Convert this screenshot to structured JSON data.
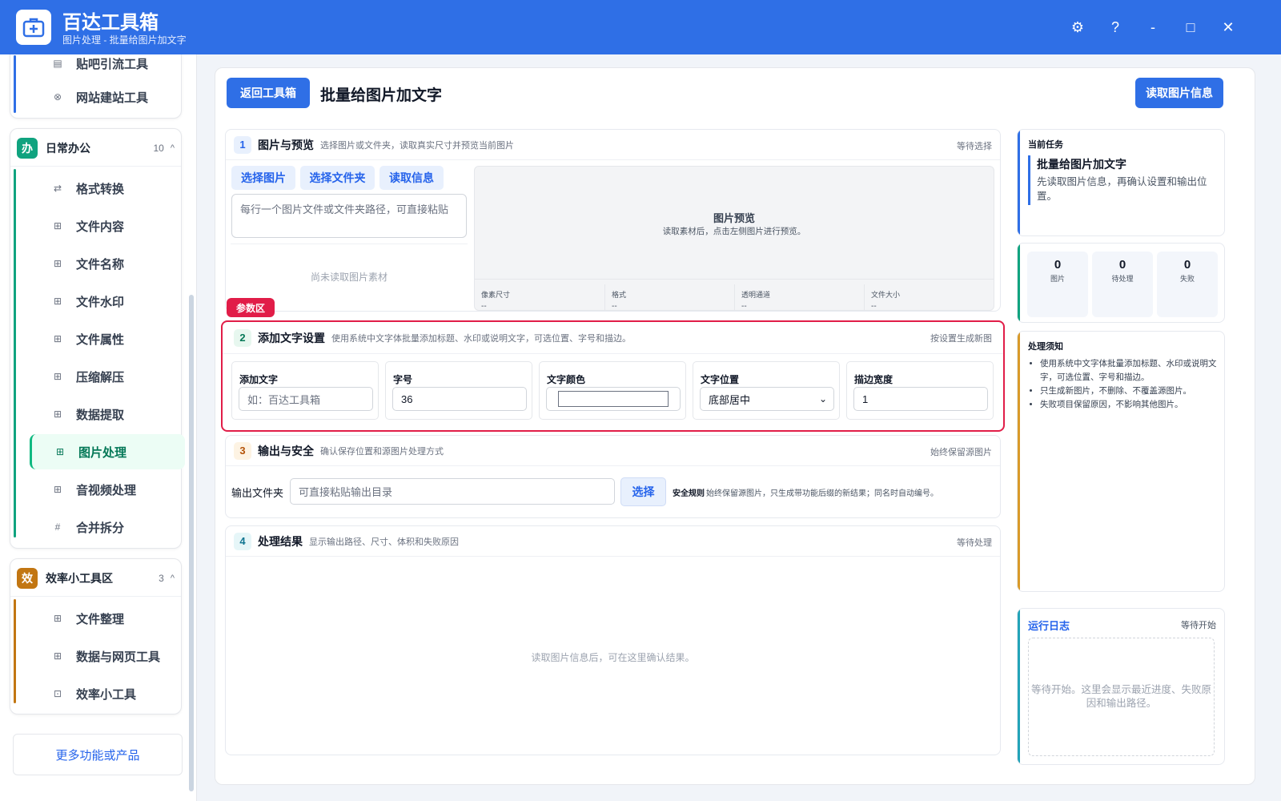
{
  "app": {
    "name": "百达工具箱",
    "subtitle": "图片处理 - 批量给图片加文字"
  },
  "window_controls": {
    "settings": "⚙",
    "help": "?",
    "minimize": "-",
    "maximize": "□",
    "close": "✕"
  },
  "sidebar": {
    "top_items": [
      "贴吧引流工具",
      "网站建站工具"
    ],
    "sections": [
      {
        "badge": "办",
        "title": "日常办公",
        "count": "10",
        "chevron": "^",
        "color": "#10a37f",
        "items": [
          "格式转换",
          "文件内容",
          "文件名称",
          "文件水印",
          "文件属性",
          "压缩解压",
          "数据提取",
          "图片处理",
          "音视频处理",
          "合并拆分"
        ]
      },
      {
        "badge": "效",
        "title": "效率小工具区",
        "count": "3",
        "chevron": "^",
        "color": "#c27612",
        "items": [
          "文件整理",
          "数据与网页工具",
          "效率小工具"
        ]
      }
    ],
    "more_button": "更多功能或产品"
  },
  "header": {
    "back_button": "返回工具箱",
    "title": "批量给图片加文字",
    "read_button": "读取图片信息"
  },
  "panel1": {
    "num": "1",
    "title": "图片与预览",
    "desc": "选择图片或文件夹，读取真实尺寸并预览当前图片",
    "status": "等待选择",
    "buttons": [
      "选择图片",
      "选择文件夹",
      "读取信息"
    ],
    "path_placeholder": "每行一个图片文件或文件夹路径，可直接粘贴",
    "empty_text": "尚未读取图片素材",
    "preview_title": "图片预览",
    "preview_hint": "读取素材后，点击左侧图片进行预览。",
    "meta": [
      {
        "label": "像素尺寸",
        "value": "--"
      },
      {
        "label": "格式",
        "value": "--"
      },
      {
        "label": "透明通道",
        "value": "--"
      },
      {
        "label": "文件大小",
        "value": "--"
      }
    ]
  },
  "param_tag": "参数区",
  "panel2": {
    "num": "2",
    "title": "添加文字设置",
    "desc": "使用系统中文字体批量添加标题、水印或说明文字，可选位置、字号和描边。",
    "status": "按设置生成新图",
    "fields": {
      "text_label": "添加文字",
      "text_placeholder": "如：百达工具箱",
      "size_label": "字号",
      "size_value": "36",
      "color_label": "文字颜色",
      "color_value": "#ffffff",
      "position_label": "文字位置",
      "position_value": "底部居中",
      "stroke_label": "描边宽度",
      "stroke_value": "1"
    }
  },
  "panel3": {
    "num": "3",
    "title": "输出与安全",
    "desc": "确认保存位置和源图片处理方式",
    "status": "始终保留源图片",
    "output_label": "输出文件夹",
    "output_placeholder": "可直接粘贴输出目录",
    "choose_button": "选择",
    "rule_label": "安全规则",
    "rule_text": "始终保留源图片，只生成带功能后缀的新结果；同名时自动编号。"
  },
  "panel4": {
    "num": "4",
    "title": "处理结果",
    "desc": "显示输出路径、尺寸、体积和失败原因",
    "status": "等待处理",
    "empty_text": "读取图片信息后，可在这里确认结果。"
  },
  "right": {
    "task_label": "当前任务",
    "task_title": "批量给图片加文字",
    "task_desc": "先读取图片信息，再确认设置和输出位置。",
    "stats": [
      {
        "value": "0",
        "label": "图片"
      },
      {
        "value": "0",
        "label": "待处理"
      },
      {
        "value": "0",
        "label": "失败"
      }
    ],
    "notes_title": "处理须知",
    "notes": [
      "使用系统中文字体批量添加标题、水印或说明文字，可选位置、字号和描边。",
      "只生成新图片，不删除、不覆盖源图片。",
      "失败项目保留原因，不影响其他图片。"
    ],
    "log_title": "运行日志",
    "log_status": "等待开始",
    "log_text": "等待开始。这里会显示最近进度、失败原因和输出路径。"
  },
  "colors": {
    "primary": "#2f6fe6",
    "office": "#10a37f",
    "efficiency": "#c27612",
    "highlight": "#e11d48"
  }
}
